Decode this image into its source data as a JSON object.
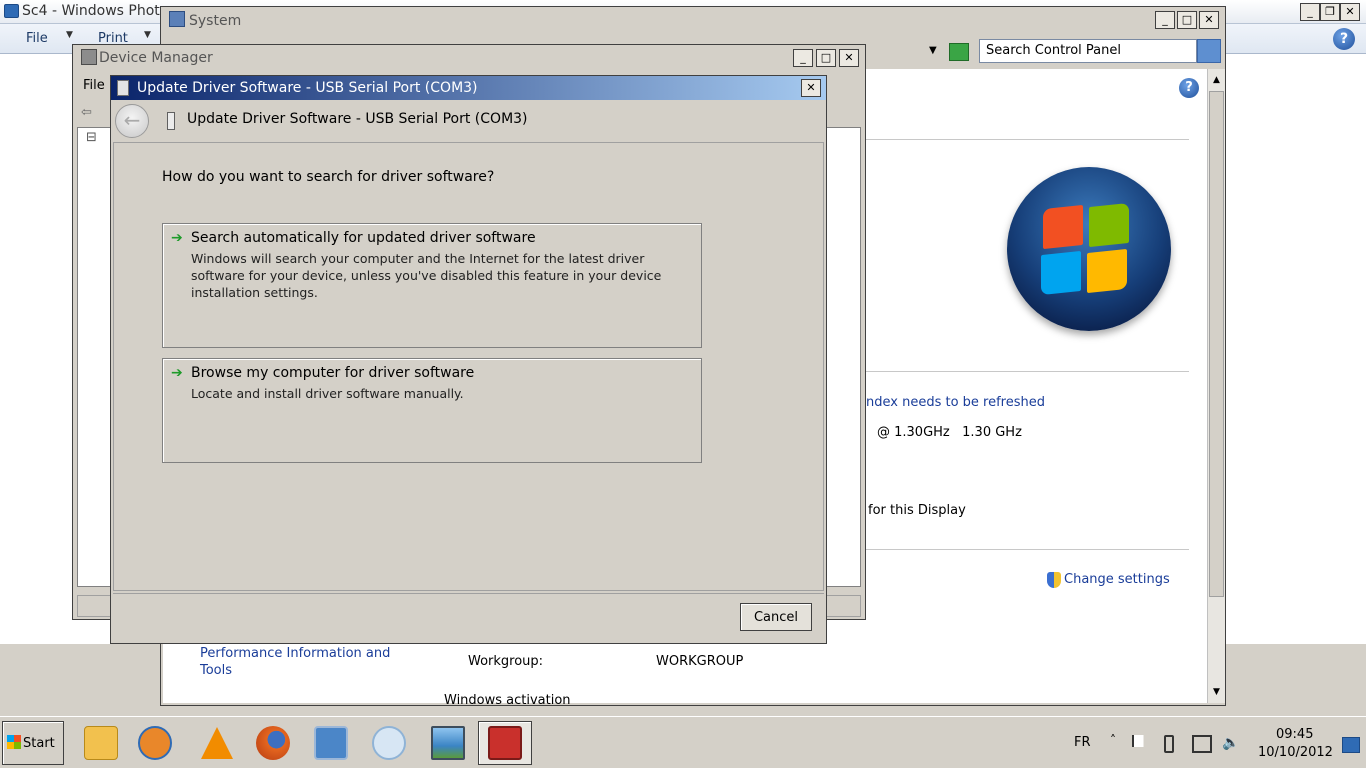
{
  "photo_viewer": {
    "title": "Sc4 - Windows Phot",
    "menu_file": "File",
    "menu_print": "Print",
    "help": "?"
  },
  "system_window": {
    "title": "System",
    "search_placeholder": "Search Control Panel",
    "help": "?",
    "index_link": "ndex needs to be refreshed",
    "processor": "@ 1.30GHz   1.30 GHz",
    "processor_prefix": ")",
    "display_text": "for this Display",
    "change_settings": "Change settings",
    "perf_link": "Performance Information and Tools",
    "workgroup_label": "Workgroup:",
    "workgroup_value": "WORKGROUP",
    "activation_label": "Windows activation"
  },
  "device_manager": {
    "title": "Device Manager",
    "menu_file": "File",
    "tree_expander": "⊟"
  },
  "dialog": {
    "window_title": "Update Driver Software - USB Serial Port (COM3)",
    "header_title": "Update Driver Software - USB Serial Port (COM3)",
    "question": "How do you want to search for driver software?",
    "options": [
      {
        "title": "Search automatically for updated driver software",
        "description": "Windows will search your computer and the Internet for the latest driver software for your device, unless you've disabled this feature in your device installation settings."
      },
      {
        "title": "Browse my computer for driver software",
        "description": "Locate and install driver software manually."
      }
    ],
    "cancel": "Cancel",
    "close": "✕"
  },
  "taskbar": {
    "start": "Start",
    "apps": [
      {
        "icon": "folder-icon",
        "color": "#f2c14e"
      },
      {
        "icon": "media-player-icon",
        "color": "#e9872a"
      },
      {
        "icon": "vlc-icon",
        "color": "#f28c00"
      },
      {
        "icon": "firefox-icon",
        "color": "#d5531e"
      },
      {
        "icon": "remote-desktop-icon",
        "color": "#4b86c8"
      },
      {
        "icon": "paint-icon",
        "color": "#8fb3d6"
      },
      {
        "icon": "photo-viewer-icon",
        "color": "#3b84c4"
      },
      {
        "icon": "toolbox-icon",
        "color": "#c9302c"
      }
    ],
    "language": "FR",
    "time": "09:45",
    "date": "10/10/2012",
    "show_hidden": "˄"
  }
}
